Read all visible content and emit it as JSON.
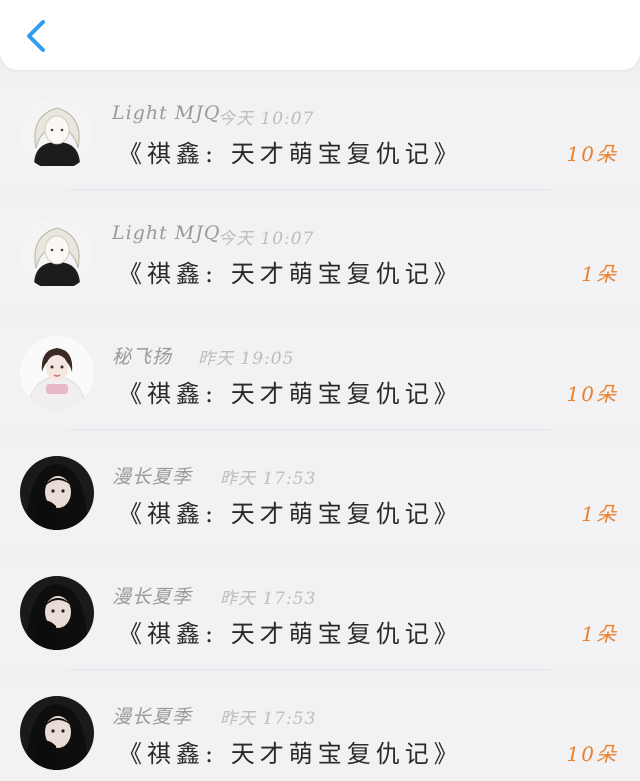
{
  "header": {
    "back_icon": "chevron-left-icon",
    "accent": "#2e9df0"
  },
  "items": [
    {
      "name": "Light MJQ",
      "time": "今天 10:07",
      "book": "《祺鑫: 天才萌宝复仇记》",
      "amount": "10朵",
      "avatar": "anime-girl-white-hair"
    },
    {
      "name": "Light MJQ",
      "time": "今天 10:07",
      "book": "《祺鑫: 天才萌宝复仇记》",
      "amount": "1朵",
      "avatar": "anime-girl-white-hair"
    },
    {
      "name": "秘飞扬",
      "time": "昨天 19:05",
      "book": "《祺鑫: 天才萌宝复仇记》",
      "amount": "10朵",
      "avatar": "girl-white-hood"
    },
    {
      "name": "漫长夏季",
      "time": "昨天 17:53",
      "book": "《祺鑫: 天才萌宝复仇记》",
      "amount": "1朵",
      "avatar": "girl-dark-hair"
    },
    {
      "name": "漫长夏季",
      "time": "昨天 17:53",
      "book": "《祺鑫: 天才萌宝复仇记》",
      "amount": "1朵",
      "avatar": "girl-dark-hair"
    },
    {
      "name": "漫长夏季",
      "time": "昨天 17:53",
      "book": "《祺鑫: 天才萌宝复仇记》",
      "amount": "10朵",
      "avatar": "girl-dark-hair"
    }
  ],
  "colors": {
    "amount": "#e8822e",
    "name": "#9a9a9a",
    "book": "#2a2a2a"
  }
}
